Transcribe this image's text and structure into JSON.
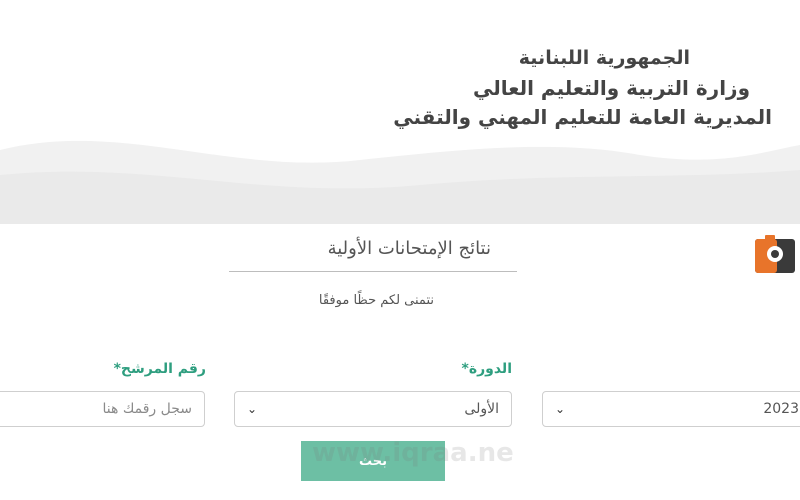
{
  "header": {
    "line1": "الجمهورية اللبنانية",
    "line2": "وزارة التربية والتعليم العالي",
    "line3": "المديرية العامة للتعليم المهني والتقني"
  },
  "title": "نتائج الإمتحانات الأولية",
  "subtitle": "نتمنى لكم حظًا موفقًا",
  "form": {
    "candidate_label": "رقم المرشح*",
    "candidate_placeholder": "سجل رقمك هنا",
    "session_label": "الدورة*",
    "session_value": "الأولى",
    "year_label": "*",
    "year_value": "2023",
    "search_label": "بحث"
  },
  "watermark": "www.iqraa.ne",
  "colors": {
    "accent_green": "#2e9e7f",
    "button_bg": "#6dbfa4",
    "logo_orange": "#e8742a"
  }
}
